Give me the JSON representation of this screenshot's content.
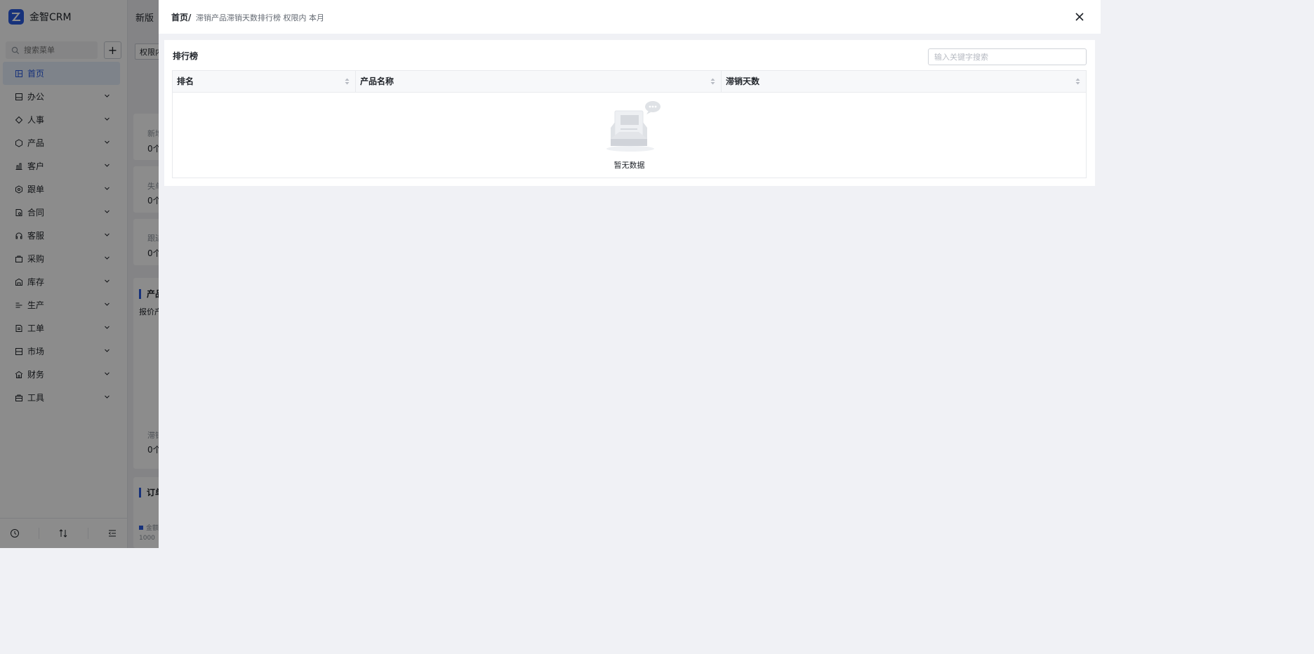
{
  "app": {
    "brand_name": "金智CRM",
    "search_placeholder": "搜索菜单",
    "add_label": "+",
    "menu": [
      {
        "label": "首页",
        "icon": "dashboard-icon",
        "active": true
      },
      {
        "label": "办公",
        "icon": "office-icon"
      },
      {
        "label": "人事",
        "icon": "hr-icon"
      },
      {
        "label": "产品",
        "icon": "product-icon"
      },
      {
        "label": "客户",
        "icon": "customer-icon"
      },
      {
        "label": "跟单",
        "icon": "follow-icon"
      },
      {
        "label": "合同",
        "icon": "contract-icon"
      },
      {
        "label": "客服",
        "icon": "service-icon"
      },
      {
        "label": "采购",
        "icon": "purchase-icon"
      },
      {
        "label": "库存",
        "icon": "inventory-icon"
      },
      {
        "label": "生产",
        "icon": "production-icon"
      },
      {
        "label": "工单",
        "icon": "workorder-icon"
      },
      {
        "label": "市场",
        "icon": "market-icon"
      },
      {
        "label": "财务",
        "icon": "finance-icon"
      },
      {
        "label": "工具",
        "icon": "tools-icon"
      }
    ],
    "footer_icons": [
      "history-icon",
      "sort-icon",
      "collapse-menu-icon"
    ]
  },
  "background": {
    "title": "新版",
    "filter_label": "权限内",
    "cards": [
      {
        "label": "新增",
        "value": "0个"
      },
      {
        "label": "失单",
        "value": "0个"
      },
      {
        "label": "跟进",
        "value": "0个"
      },
      {
        "label": "滞销",
        "value": "0个"
      }
    ],
    "section_product": "产品",
    "section_product_sub": "报价产",
    "section_order": "订单",
    "legend_label": "金额",
    "axis_value": "1000"
  },
  "drawer": {
    "breadcrumb_home": "首页/",
    "breadcrumb_rest": "滞销产品滞销天数排行榜  权限内 本月",
    "panel_title": "排行榜",
    "search_placeholder": "输入关键字搜索",
    "columns": [
      "排名",
      "产品名称",
      "滞销天数"
    ],
    "empty_text": "暂无数据"
  },
  "colors": {
    "accent": "#2b5be0",
    "overlay": "rgba(0,0,0,0.45)"
  }
}
